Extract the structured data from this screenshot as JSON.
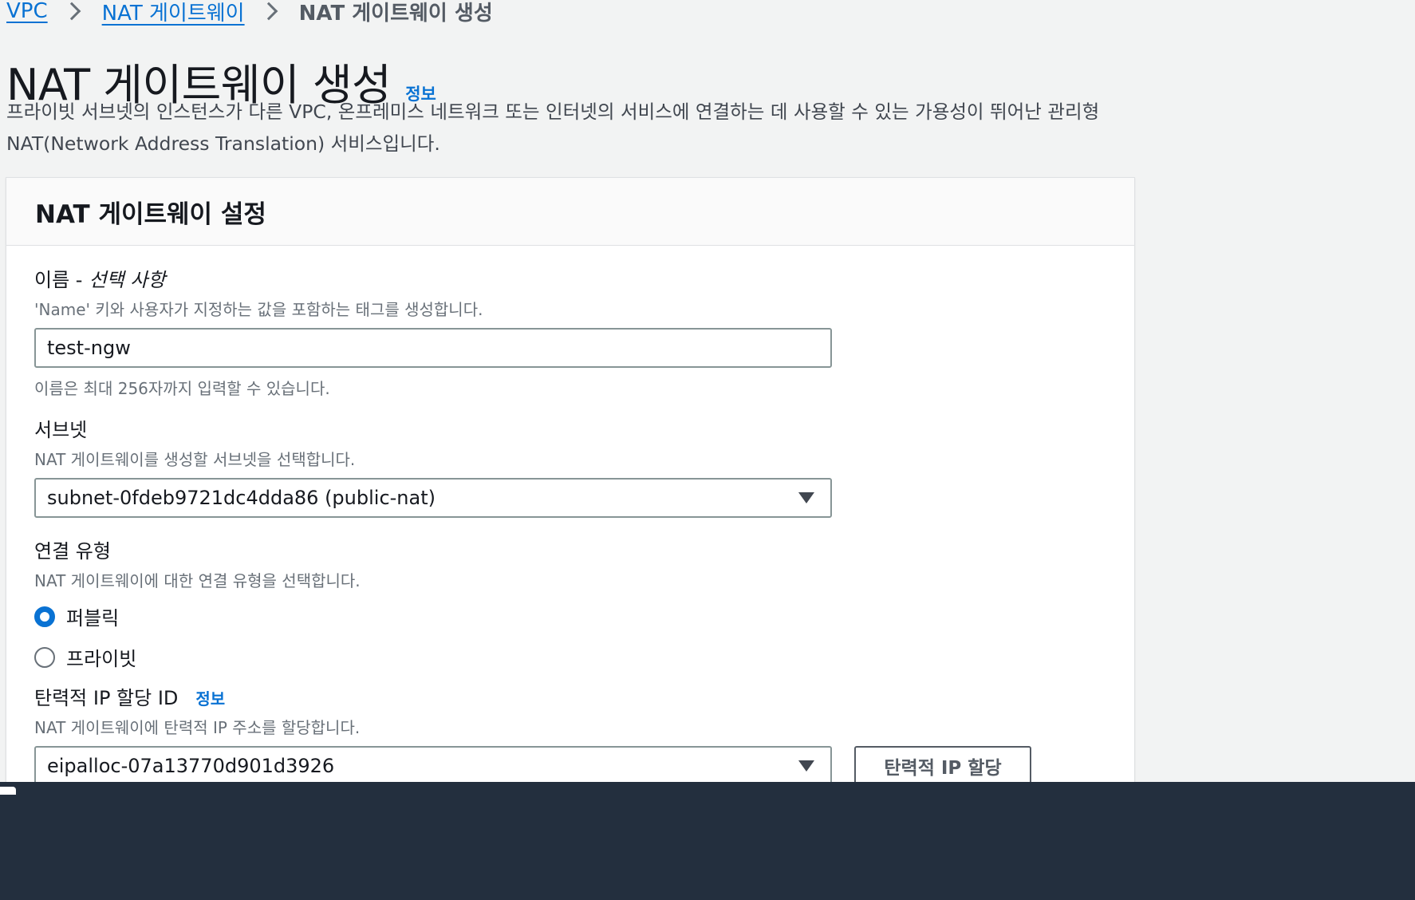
{
  "breadcrumb": {
    "items": [
      {
        "label": "VPC"
      },
      {
        "label": "NAT 게이트웨이"
      }
    ],
    "current": "NAT 게이트웨이 생성"
  },
  "header": {
    "title": "NAT 게이트웨이 생성",
    "info": "정보",
    "description": "프라이빗 서브넷의 인스턴스가 다른 VPC, 온프레미스 네트워크 또는 인터넷의 서비스에 연결하는 데 사용할 수 있는 가용성이 뛰어난 관리형 NAT(Network Address Translation) 서비스입니다."
  },
  "panel": {
    "title": "NAT 게이트웨이 설정",
    "name_field": {
      "label": "이름 -",
      "label_optional": "선택 사항",
      "description": "'Name' 키와 사용자가 지정하는 값을 포함하는 태그를 생성합니다.",
      "value": "test-ngw",
      "constraint": "이름은 최대 256자까지 입력할 수 있습니다."
    },
    "subnet_field": {
      "label": "서브넷",
      "description": "NAT 게이트웨이를 생성할 서브넷을 선택합니다.",
      "value": "subnet-0fdeb9721dc4dda86 (public-nat)"
    },
    "connectivity_field": {
      "label": "연결 유형",
      "description": "NAT 게이트웨이에 대한 연결 유형을 선택합니다.",
      "options": [
        {
          "label": "퍼블릭",
          "selected": true
        },
        {
          "label": "프라이빗",
          "selected": false
        }
      ]
    },
    "eip_field": {
      "label": "탄력적 IP 할당 ID",
      "info": "정보",
      "description": "NAT 게이트웨이에 탄력적 IP 주소를 할당합니다.",
      "value": "eipalloc-07a13770d901d3926",
      "button_label": "탄력적 IP 할당"
    }
  },
  "colors": {
    "link": "#0972d3",
    "background": "#f2f3f3",
    "bottom_bar": "#232f3e"
  }
}
